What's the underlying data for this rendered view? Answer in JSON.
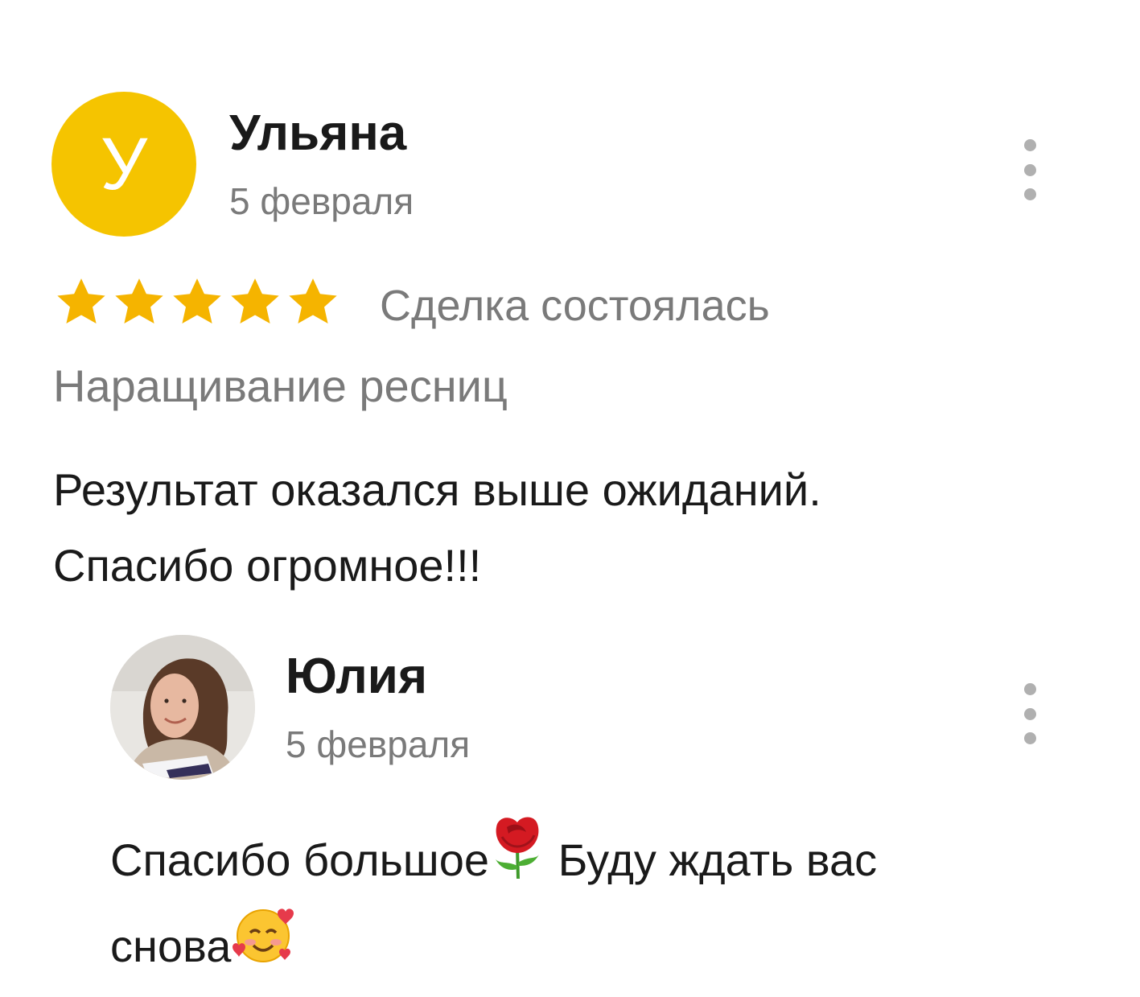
{
  "review": {
    "author_initial": "У",
    "author_name": "Ульяна",
    "date": "5 февраля",
    "rating": 5,
    "rating_max": 5,
    "star_color": "#f5b400",
    "status": "Сделка состоялась",
    "service": "Наращивание ресниц",
    "text_line1": "Результат оказался выше ожиданий.",
    "text_line2": "Спасибо огромное!!!",
    "avatar_color": "#f5c400"
  },
  "reply": {
    "author_name": "Юлия",
    "date": "5 февраля",
    "text_part1": "Спасибо большое",
    "emoji1": "rose-emoji",
    "text_part2": " Буду ждать вас",
    "text_part3": "снова",
    "emoji2": "smiling-face-with-hearts-emoji"
  },
  "icons": {
    "menu": "more-vertical-icon",
    "star": "star-icon"
  }
}
